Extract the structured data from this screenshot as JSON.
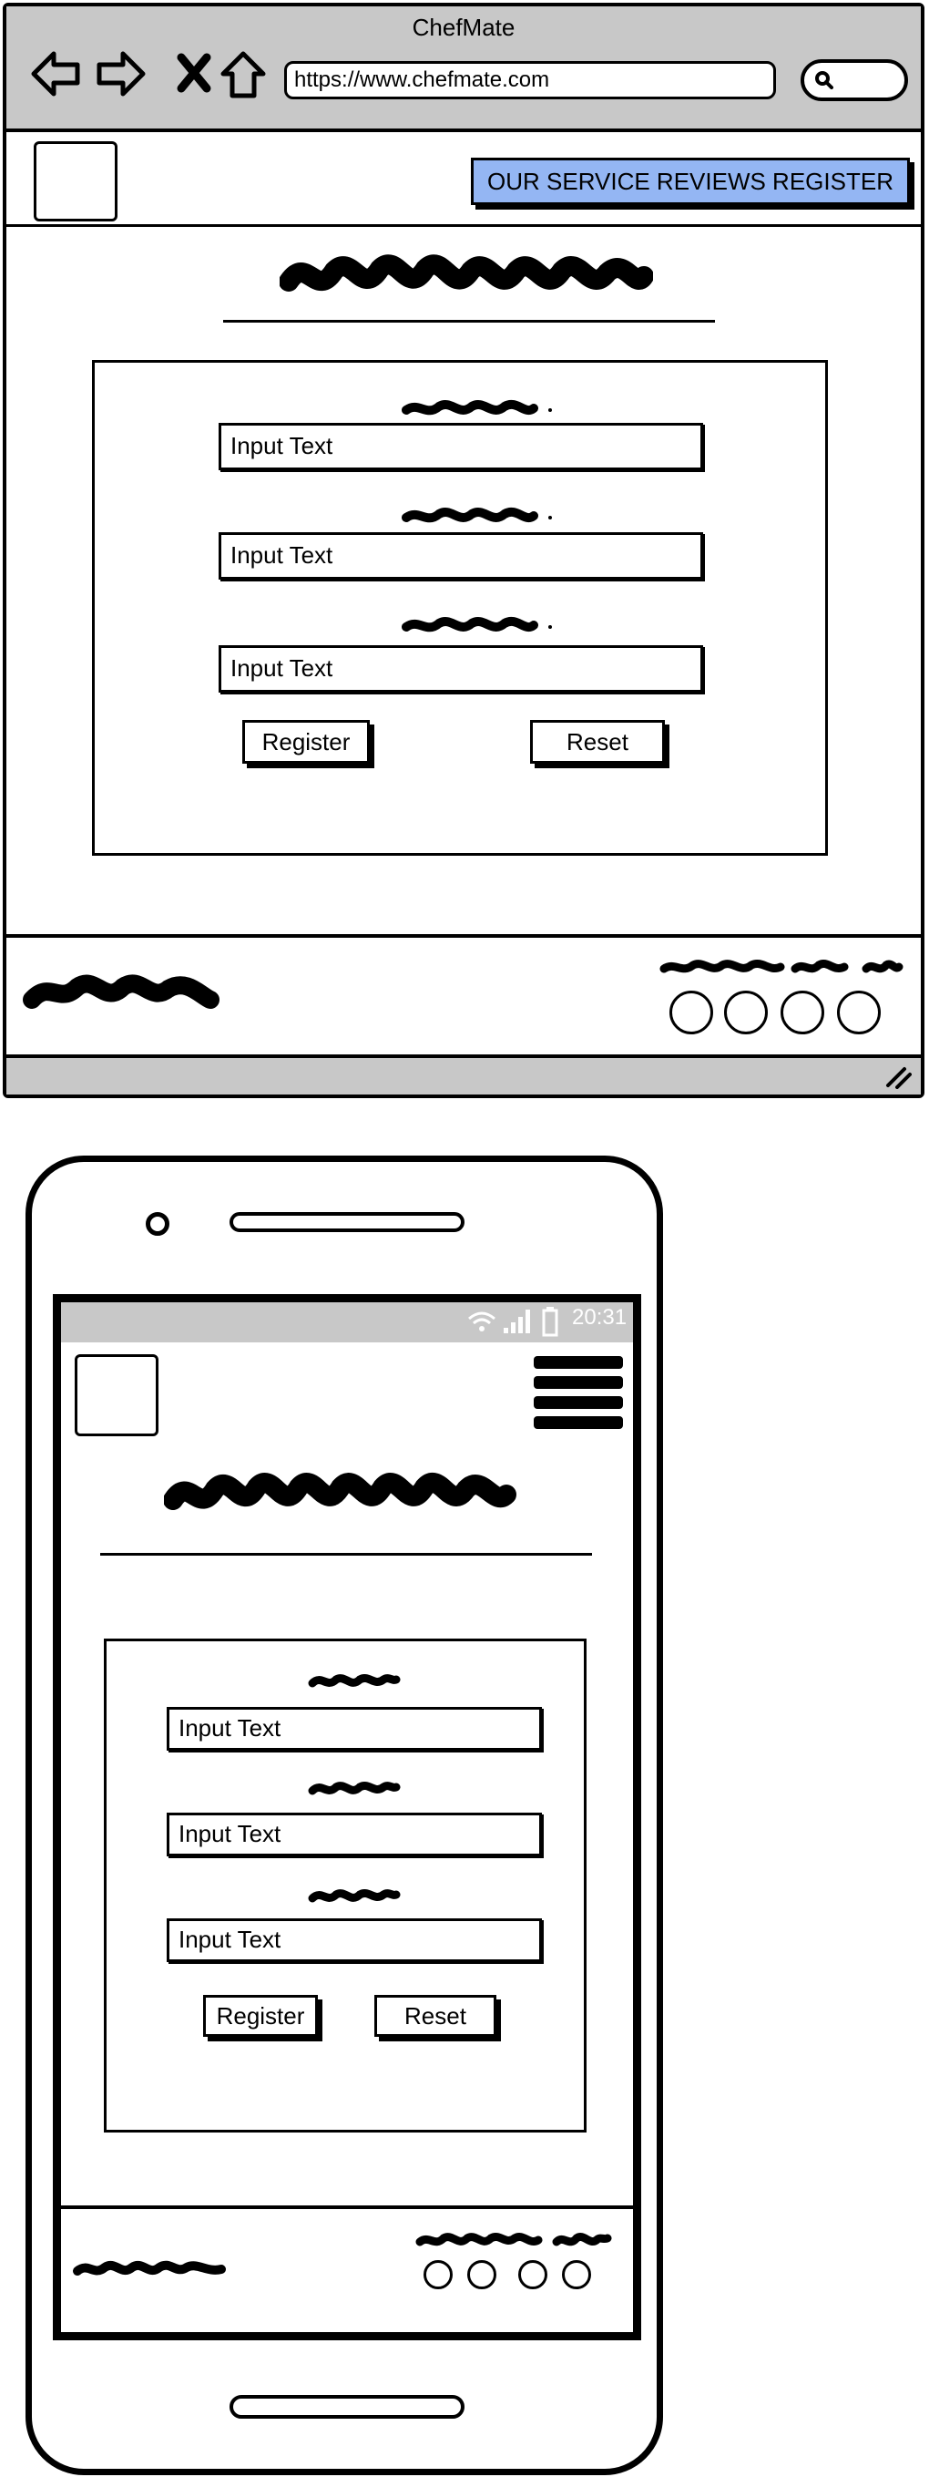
{
  "desktop": {
    "window_title": "ChefMate",
    "url": "https://www.chefmate.com",
    "nav_button": "OUR SERVICE REVIEWS REGISTER",
    "form": {
      "fields": [
        "Input Text",
        "Input Text",
        "Input Text"
      ],
      "register_label": "Register",
      "reset_label": "Reset"
    },
    "footer": {
      "social_count": 4
    }
  },
  "mobile": {
    "status_time": "20:31",
    "form": {
      "fields": [
        "Input Text",
        "Input Text",
        "Input Text"
      ],
      "register_label": "Register",
      "reset_label": "Reset"
    },
    "footer": {
      "social_count": 4
    }
  },
  "colors": {
    "accent": "#94b6f3",
    "chrome": "#c8c8c8"
  },
  "icons": [
    "back-arrow-icon",
    "forward-arrow-icon",
    "close-icon",
    "home-icon",
    "search-icon",
    "wifi-icon",
    "signal-icon",
    "battery-icon",
    "hamburger-menu-icon",
    "resize-grip-icon"
  ]
}
